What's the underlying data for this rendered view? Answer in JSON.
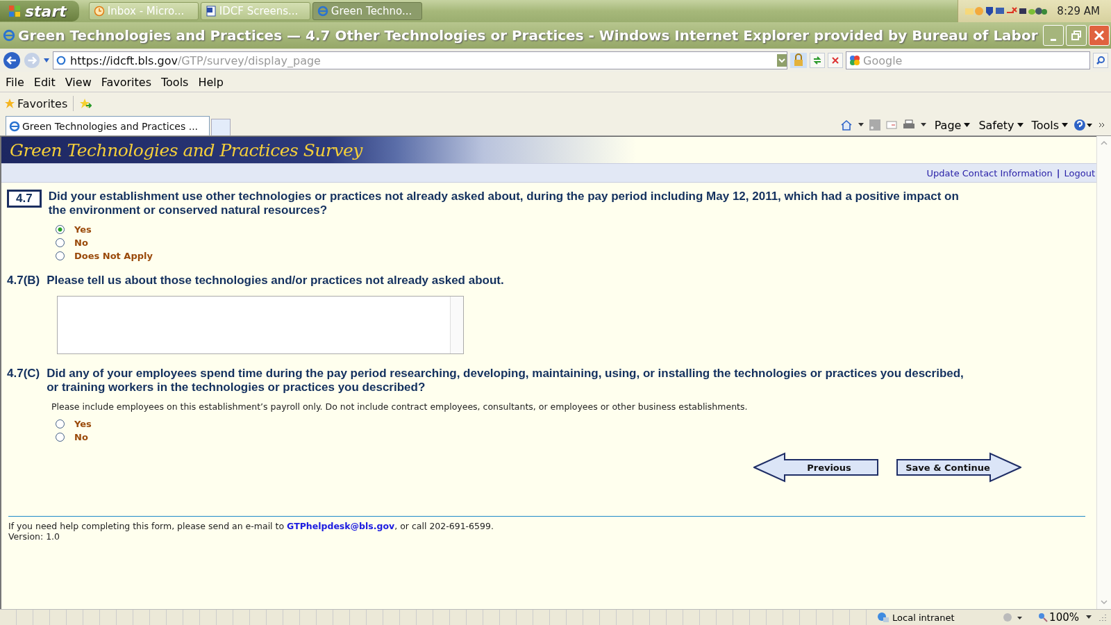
{
  "taskbar": {
    "start": "start",
    "tasks": [
      {
        "label": "Inbox - Micro...",
        "selected": false
      },
      {
        "label": "IDCF Screens...",
        "selected": false
      },
      {
        "label": "Green Techno...",
        "selected": true
      }
    ],
    "clock": "8:29 AM"
  },
  "window": {
    "title": "Green Technologies and Practices — 4.7 Other Technologies or Practices - Windows Internet Explorer provided by Bureau of Labor"
  },
  "address_bar": {
    "url_host": "https://idcft.bls.gov",
    "url_path": "/GTP/survey/display_page",
    "search_placeholder": "Google"
  },
  "menu": [
    "File",
    "Edit",
    "View",
    "Favorites",
    "Tools",
    "Help"
  ],
  "favorites_bar": {
    "label": "Favorites"
  },
  "tabs": [
    {
      "label": "Green Technologies and Practices ...",
      "selected": true
    }
  ],
  "command_bar": [
    "Page",
    "Safety",
    "Tools"
  ],
  "page": {
    "banner": "Green Technologies and Practices Survey",
    "links": [
      "Update Contact Information",
      "Logout"
    ],
    "link_separator": "|",
    "questions": [
      {
        "number": "4.7",
        "boxed": true,
        "kind": "radio",
        "text": "Did your establishment use other technologies or practices not already asked about, during the pay period including May 12, 2011, which had a positive impact on the environment or conserved natural resources?",
        "options": [
          {
            "label": "Yes",
            "selected": true
          },
          {
            "label": "No",
            "selected": false
          },
          {
            "label": "Does Not Apply",
            "selected": false
          }
        ]
      },
      {
        "number": "4.7(B)",
        "boxed": false,
        "kind": "textarea",
        "text": "Please tell us about those technologies and/or practices not already asked about."
      },
      {
        "number": "4.7(C)",
        "boxed": false,
        "kind": "radio",
        "text": "Did any of your employees spend time during the pay period researching, developing, maintaining, using, or installing the technologies or practices you described, or training workers in the technologies or practices you described?",
        "note": "Please include employees on this establishment’s payroll only. Do not include contract employees, consultants, or employees or other business establishments.",
        "options": [
          {
            "label": "Yes",
            "selected": false
          },
          {
            "label": "No",
            "selected": false
          }
        ]
      }
    ],
    "previous": "Previous",
    "save": "Save & Continue",
    "help_before": "If you need help completing this form, please send an e-mail to",
    "help_email": "GTPhelpdesk@bls.gov",
    "help_after": ", or call 202-691-6599.",
    "version": "Version: 1.0"
  },
  "status_bar": {
    "zone": "Local intranet",
    "zoom": "100%"
  }
}
